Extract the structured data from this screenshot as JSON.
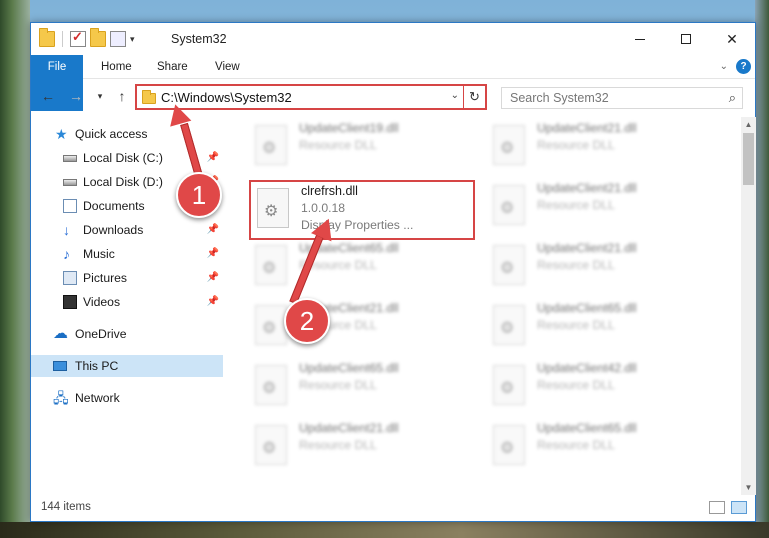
{
  "window": {
    "title": "System32"
  },
  "ribbon": {
    "file": "File",
    "home": "Home",
    "share": "Share",
    "view": "View",
    "help": "?"
  },
  "address": {
    "path": "C:\\Windows\\System32"
  },
  "search": {
    "placeholder": "Search System32"
  },
  "sidebar": {
    "items": [
      {
        "label": "Quick access",
        "icon": "star-icon"
      },
      {
        "label": "Local Disk (C:)",
        "icon": "drive-icon",
        "pinned": true
      },
      {
        "label": "Local Disk (D:)",
        "icon": "drive-icon",
        "pinned": true
      },
      {
        "label": "Documents",
        "icon": "documents-icon",
        "pinned": true
      },
      {
        "label": "Downloads",
        "icon": "download-icon",
        "pinned": true
      },
      {
        "label": "Music",
        "icon": "music-icon",
        "pinned": true
      },
      {
        "label": "Pictures",
        "icon": "pictures-icon",
        "pinned": true
      },
      {
        "label": "Videos",
        "icon": "videos-icon",
        "pinned": true
      },
      {
        "label": "OneDrive",
        "icon": "cloud-icon"
      },
      {
        "label": "This PC",
        "icon": "computer-icon",
        "selected": true
      },
      {
        "label": "Network",
        "icon": "network-icon"
      }
    ]
  },
  "files": {
    "left": [
      {
        "name": "UpdateClient19.dll",
        "desc": "Resource DLL"
      },
      {
        "name": "clrefrsh.dll",
        "version": "1.0.0.18",
        "desc": "Display Properties ...",
        "selected": true
      },
      {
        "name": "UpdateClient65.dll",
        "desc": "Resource DLL"
      },
      {
        "name": "UpdateClient21.dll",
        "desc": "Resource DLL"
      },
      {
        "name": "UpdateClient65.dll",
        "desc": "Resource DLL"
      },
      {
        "name": "UpdateClient21.dll",
        "desc": "Resource DLL"
      }
    ],
    "right": [
      {
        "name": "UpdateClient21.dll",
        "desc": "Resource DLL"
      },
      {
        "name": "UpdateClient21.dll",
        "desc": "Resource DLL"
      },
      {
        "name": "UpdateClient21.dll",
        "desc": "Resource DLL"
      },
      {
        "name": "UpdateClient65.dll",
        "desc": "Resource DLL"
      },
      {
        "name": "UpdateClient42.dll",
        "desc": "Resource DLL"
      },
      {
        "name": "UpdateClient65.dll",
        "desc": "Resource DLL"
      }
    ]
  },
  "status": {
    "count": "144 items"
  },
  "annotations": {
    "step1": "1",
    "step2": "2"
  },
  "colors": {
    "accent": "#1979ca",
    "highlight": "#d64545",
    "badge": "#e04848"
  }
}
